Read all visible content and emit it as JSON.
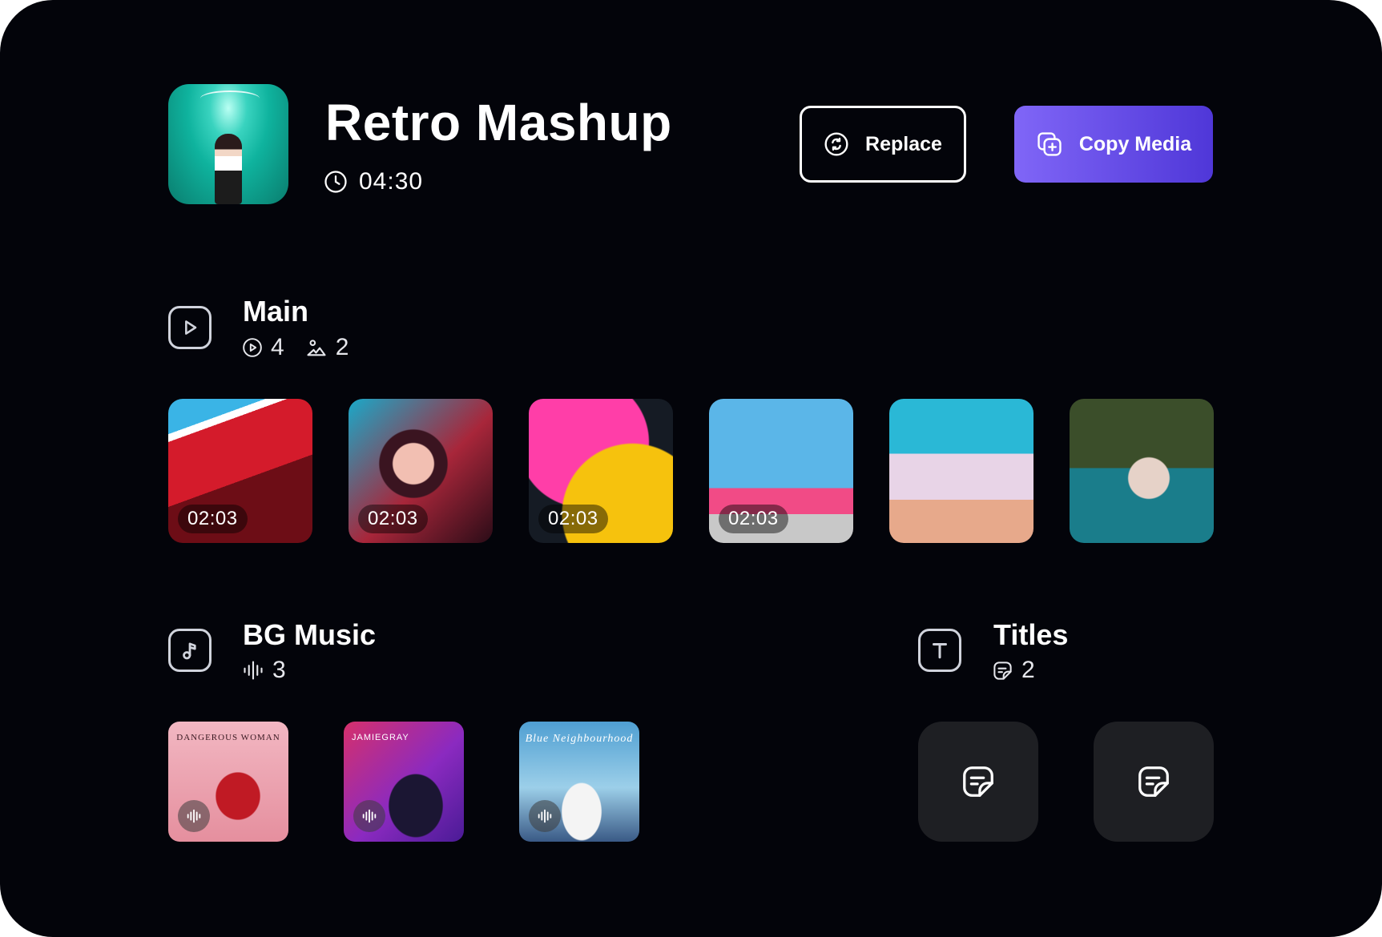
{
  "project": {
    "title": "Retro Mashup",
    "duration": "04:30"
  },
  "actions": {
    "replace_label": "Replace",
    "copy_label": "Copy Media"
  },
  "main": {
    "title": "Main",
    "video_count": "4",
    "image_count": "2",
    "items": [
      {
        "time": "02:03"
      },
      {
        "time": "02:03"
      },
      {
        "time": "02:03"
      },
      {
        "time": "02:03"
      },
      {
        "time": ""
      },
      {
        "time": ""
      }
    ]
  },
  "bg_music": {
    "title": "BG Music",
    "track_count": "3",
    "tracks": [
      {
        "cover_text": "DANGEROUS WOMAN"
      },
      {
        "cover_text": "JAMIEGRAY"
      },
      {
        "cover_text": "Blue Neighbourhood"
      }
    ]
  },
  "titles": {
    "title": "Titles",
    "count": "2"
  },
  "colors": {
    "background": "#03040a",
    "accent_start": "#8066f7",
    "accent_end": "#4f37d8",
    "card": "#1e1f23"
  }
}
